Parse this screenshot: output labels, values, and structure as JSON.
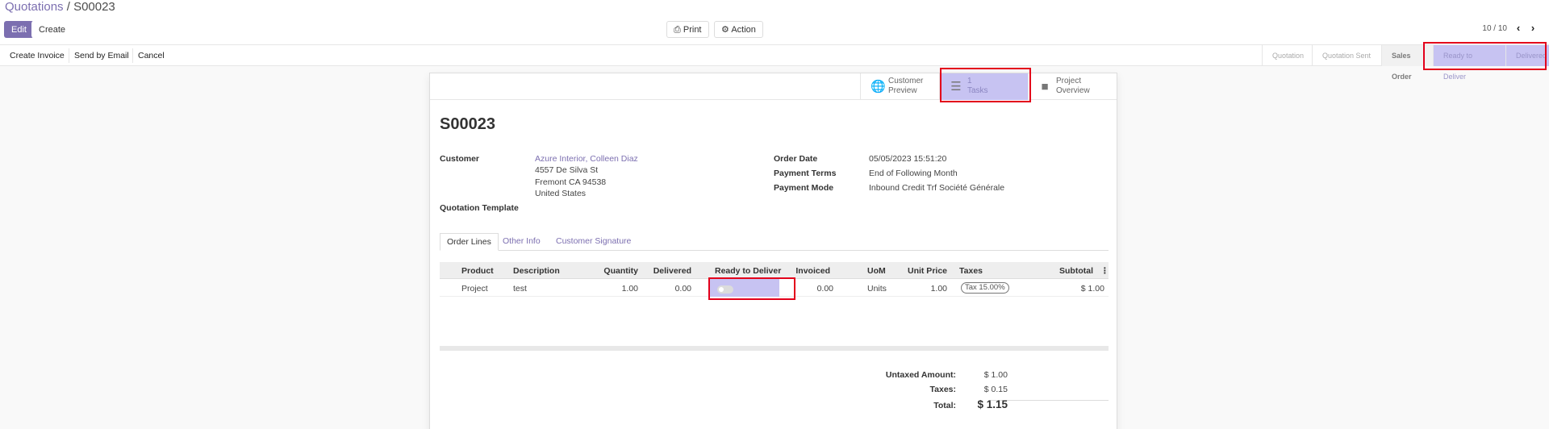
{
  "breadcrumb": {
    "parent": "Quotations",
    "separator": "/",
    "current": "S00023"
  },
  "toolbar": {
    "edit": "Edit",
    "create": "Create",
    "print": "Print",
    "action": "Action"
  },
  "pager": {
    "text": "10 / 10",
    "prev": "‹",
    "next": "›"
  },
  "statusbar": {
    "buttons": [
      "Create Invoice",
      "Send by Email",
      "Cancel"
    ],
    "stages": [
      "Quotation",
      "Quotation Sent",
      "Sales Order",
      "Ready to Deliver",
      "Delivered"
    ]
  },
  "smart_buttons": {
    "customer_preview": {
      "l1": "Customer",
      "l2": "Preview",
      "icon": "globe-icon"
    },
    "tasks": {
      "l1": "1",
      "l2": "Tasks",
      "icon": "tasks-icon"
    },
    "project_overview": {
      "l1": "Project",
      "l2": "Overview",
      "icon": "puzzle-icon"
    }
  },
  "record": {
    "name": "S00023",
    "customer_label": "Customer",
    "customer_name": "Azure Interior, Colleen Diaz",
    "address1": "4557 De Silva St",
    "address2": "Fremont CA 94538",
    "address3": "United States",
    "quotation_template_label": "Quotation Template",
    "order_date_label": "Order Date",
    "order_date": "05/05/2023 15:51:20",
    "payment_terms_label": "Payment Terms",
    "payment_terms": "End of Following Month",
    "payment_mode_label": "Payment Mode",
    "payment_mode": "Inbound Credit Trf Société Générale"
  },
  "tabs": [
    "Order Lines",
    "Other Info",
    "Customer Signature"
  ],
  "lines": {
    "headers": {
      "product": "Product",
      "description": "Description",
      "quantity": "Quantity",
      "delivered": "Delivered",
      "ready": "Ready to Deliver",
      "invoiced": "Invoiced",
      "uom": "UoM",
      "unit_price": "Unit Price",
      "taxes": "Taxes",
      "subtotal": "Subtotal",
      "menu": "⋮"
    },
    "row": {
      "product": "Project",
      "description": "test",
      "quantity": "1.00",
      "delivered": "0.00",
      "invoiced": "0.00",
      "uom": "Units",
      "unit_price": "1.00",
      "taxes": "Tax 15.00%",
      "subtotal": "$ 1.00"
    }
  },
  "totals": {
    "untaxed_label": "Untaxed Amount:",
    "untaxed": "$ 1.00",
    "taxes_label": "Taxes:",
    "taxes": "$ 0.15",
    "total_label": "Total:",
    "total": "$ 1.15"
  }
}
